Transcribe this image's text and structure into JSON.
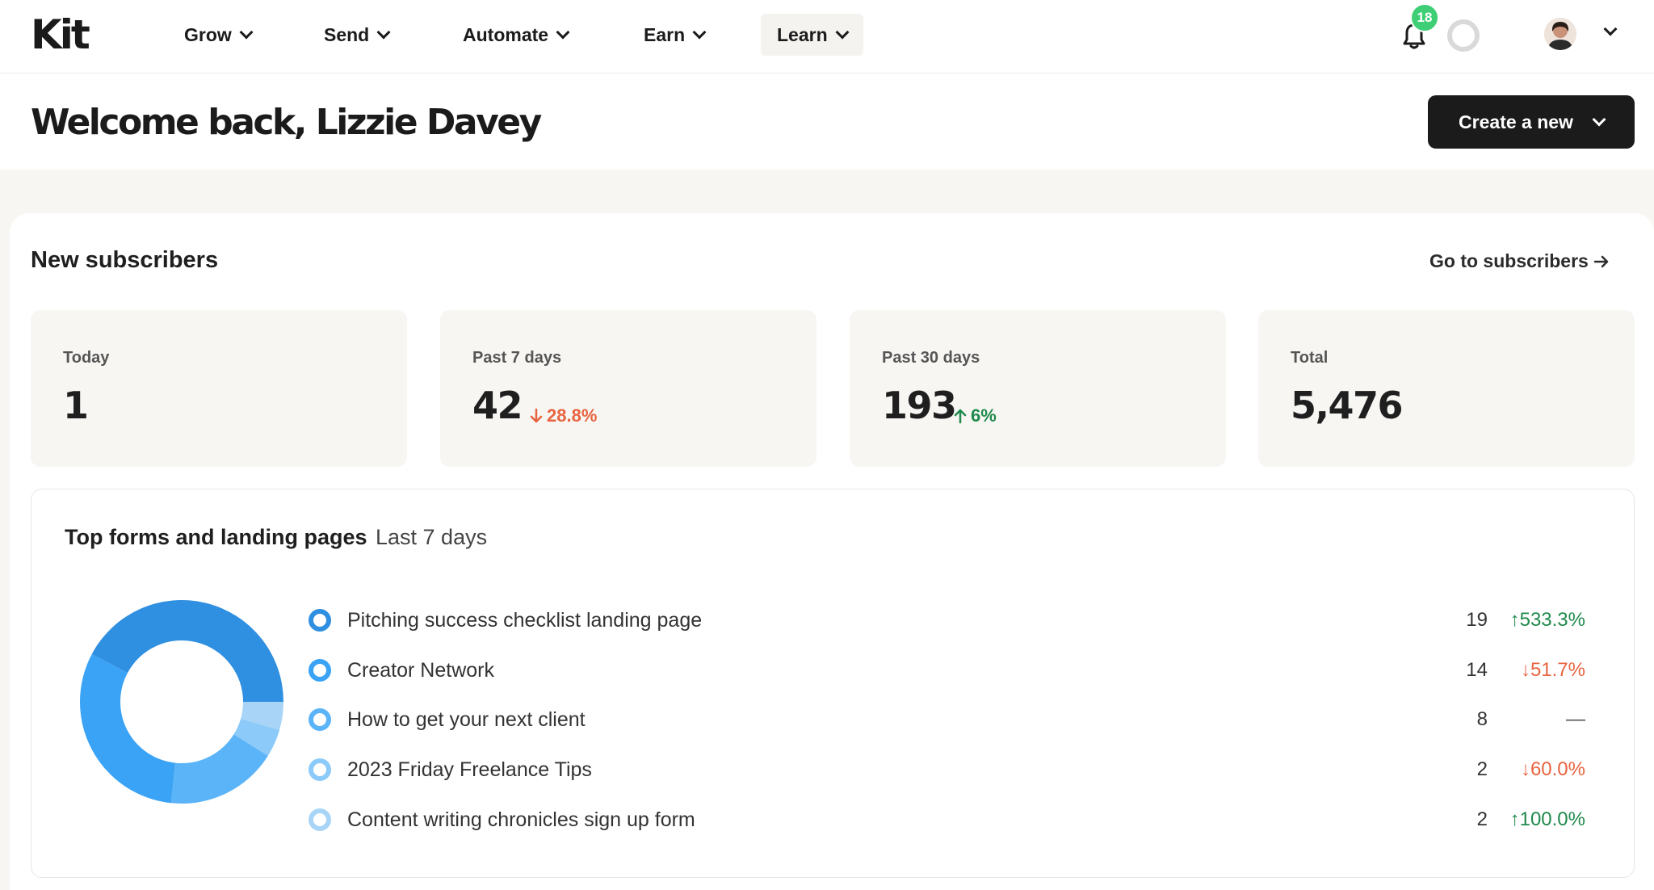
{
  "app": {
    "logo": "Kit"
  },
  "nav": {
    "items": [
      {
        "label": "Grow",
        "active": false
      },
      {
        "label": "Send",
        "active": false
      },
      {
        "label": "Automate",
        "active": false
      },
      {
        "label": "Earn",
        "active": false
      },
      {
        "label": "Learn",
        "active": true
      }
    ],
    "notifications": "18",
    "icons": [
      "bell-icon",
      "progress-ring-icon",
      "avatar",
      "chevron-down-icon"
    ]
  },
  "header": {
    "title": "Welcome back, Lizzie Davey",
    "create_label": "Create a new"
  },
  "subscribers": {
    "title": "New subscribers",
    "link": "Go to subscribers",
    "stats": [
      {
        "label": "Today",
        "value": "1",
        "change": "",
        "direction": "none"
      },
      {
        "label": "Past 7 days",
        "value": "42",
        "change": "28.8%",
        "direction": "down"
      },
      {
        "label": "Past 30 days",
        "value": "193",
        "change": "6%",
        "direction": "up"
      },
      {
        "label": "Total",
        "value": "5,476",
        "change": "",
        "direction": "none"
      }
    ]
  },
  "forms": {
    "title": "Top forms and landing pages",
    "subtitle": "Last 7 days",
    "rows": [
      {
        "label": "Pitching success checklist landing page",
        "count": "19",
        "change": "533.3%",
        "direction": "up",
        "color": "#2f8fe0"
      },
      {
        "label": "Creator Network",
        "count": "14",
        "change": "51.7%",
        "direction": "down",
        "color": "#3aa3f5"
      },
      {
        "label": "How to get your next client",
        "count": "8",
        "change": "—",
        "direction": "none",
        "color": "#5cb4f8"
      },
      {
        "label": "2023 Friday Freelance Tips",
        "count": "2",
        "change": "60.0%",
        "direction": "down",
        "color": "#8ccaf9"
      },
      {
        "label": "Content writing chronicles sign up form",
        "count": "2",
        "change": "100.0%",
        "direction": "up",
        "color": "#a8d5f7"
      }
    ]
  },
  "colors": {
    "up": "#1f8a4c",
    "down": "#e8633f",
    "badge": "#3ecf76",
    "dark": "#1b1b1b"
  }
}
